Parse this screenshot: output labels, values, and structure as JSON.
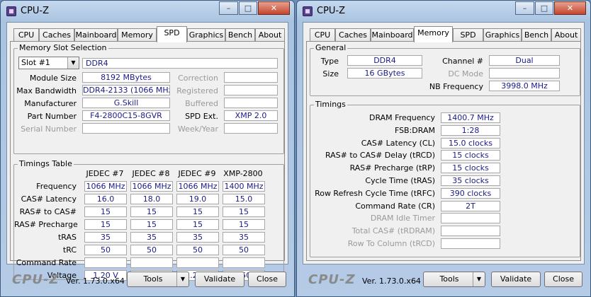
{
  "windows": [
    {
      "title": "CPU-Z",
      "tabs": [
        "CPU",
        "Caches",
        "Mainboard",
        "Memory",
        "SPD",
        "Graphics",
        "Bench",
        "About"
      ],
      "active_tab": "SPD",
      "memory_slot_selection": {
        "group_title": "Memory Slot Selection",
        "slot_select": "Slot #1",
        "type": "DDR4",
        "rows": [
          {
            "label": "Module Size",
            "value": "8192 MBytes",
            "right_label": "Correction",
            "right_value": ""
          },
          {
            "label": "Max Bandwidth",
            "value": "DDR4-2133 (1066 MHz)",
            "right_label": "Registered",
            "right_value": ""
          },
          {
            "label": "Manufacturer",
            "value": "G.Skill",
            "right_label": "Buffered",
            "right_value": ""
          },
          {
            "label": "Part Number",
            "value": "F4-2800C15-8GVR",
            "right_label": "SPD Ext.",
            "right_value": "XMP 2.0"
          },
          {
            "label": "Serial Number",
            "value": "",
            "right_label": "Week/Year",
            "right_value": ""
          }
        ]
      },
      "timings_table": {
        "group_title": "Timings Table",
        "columns": [
          "JEDEC #7",
          "JEDEC #8",
          "JEDEC #9",
          "XMP-2800"
        ],
        "rows": [
          {
            "label": "Frequency",
            "values": [
              "1066 MHz",
              "1066 MHz",
              "1066 MHz",
              "1400 MHz"
            ]
          },
          {
            "label": "CAS# Latency",
            "values": [
              "16.0",
              "18.0",
              "19.0",
              "15.0"
            ]
          },
          {
            "label": "RAS# to CAS#",
            "values": [
              "15",
              "15",
              "15",
              "15"
            ]
          },
          {
            "label": "RAS# Precharge",
            "values": [
              "15",
              "15",
              "15",
              "15"
            ]
          },
          {
            "label": "tRAS",
            "values": [
              "35",
              "35",
              "35",
              "35"
            ]
          },
          {
            "label": "tRC",
            "values": [
              "50",
              "50",
              "50",
              "50"
            ]
          },
          {
            "label": "Command Rate",
            "values": [
              "",
              "",
              "",
              ""
            ]
          },
          {
            "label": "Voltage",
            "values": [
              "1.20 V",
              "1.20 V",
              "1.20 V",
              "1.250 V"
            ]
          }
        ]
      },
      "footer": {
        "logo": "CPU-Z",
        "version": "Ver. 1.73.0.x64",
        "tools": "Tools",
        "validate": "Validate",
        "close": "Close"
      }
    },
    {
      "title": "CPU-Z",
      "tabs": [
        "CPU",
        "Caches",
        "Mainboard",
        "Memory",
        "SPD",
        "Graphics",
        "Bench",
        "About"
      ],
      "active_tab": "Memory",
      "general": {
        "group_title": "General",
        "type_label": "Type",
        "type_value": "DDR4",
        "size_label": "Size",
        "size_value": "16 GBytes",
        "channel_label": "Channel #",
        "channel_value": "Dual",
        "dc_mode_label": "DC Mode",
        "dc_mode_value": "",
        "nb_freq_label": "NB Frequency",
        "nb_freq_value": "3998.0 MHz"
      },
      "timings": {
        "group_title": "Timings",
        "rows": [
          {
            "label": "DRAM Frequency",
            "value": "1400.7 MHz",
            "dim": false
          },
          {
            "label": "FSB:DRAM",
            "value": "1:28",
            "dim": false
          },
          {
            "label": "CAS# Latency (CL)",
            "value": "15.0 clocks",
            "dim": false
          },
          {
            "label": "RAS# to CAS# Delay (tRCD)",
            "value": "15 clocks",
            "dim": false
          },
          {
            "label": "RAS# Precharge (tRP)",
            "value": "15 clocks",
            "dim": false
          },
          {
            "label": "Cycle Time (tRAS)",
            "value": "35 clocks",
            "dim": false
          },
          {
            "label": "Row Refresh Cycle Time (tRFC)",
            "value": "390 clocks",
            "dim": false
          },
          {
            "label": "Command Rate (CR)",
            "value": "2T",
            "dim": false
          },
          {
            "label": "DRAM Idle Timer",
            "value": "",
            "dim": true
          },
          {
            "label": "Total CAS# (tRDRAM)",
            "value": "",
            "dim": true
          },
          {
            "label": "Row To Column (tRCD)",
            "value": "",
            "dim": true
          }
        ]
      },
      "footer": {
        "logo": "CPU-Z",
        "version": "Ver. 1.73.0.x64",
        "tools": "Tools",
        "validate": "Validate",
        "close": "Close"
      }
    }
  ],
  "window_controls": {
    "minimize": "–",
    "maximize": "□",
    "close": "✕"
  }
}
